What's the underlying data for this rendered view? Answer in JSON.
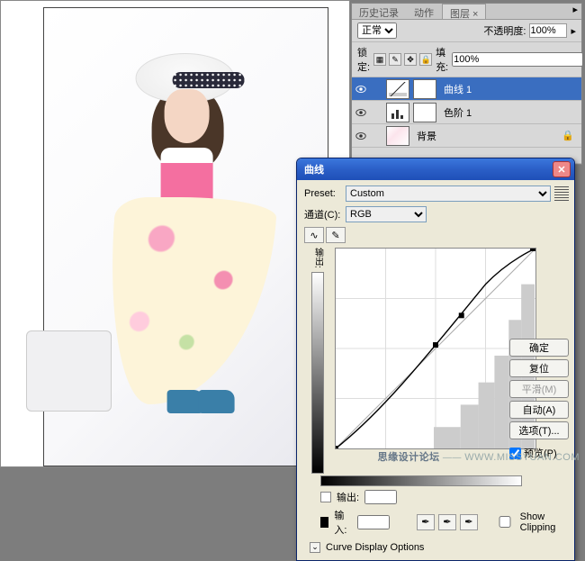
{
  "panel": {
    "tabs": [
      "历史记录",
      "动作",
      "图层"
    ],
    "active_tab": "图层",
    "blend_mode": "正常",
    "opacity_label": "不透明度:",
    "opacity_value": "100%",
    "lock_label": "锁定:",
    "fill_label": "填充:",
    "fill_value": "100%",
    "layers": [
      {
        "name": "曲线 1",
        "kind": "curves",
        "selected": true
      },
      {
        "name": "色阶 1",
        "kind": "levels",
        "selected": false
      },
      {
        "name": "背景",
        "kind": "image",
        "selected": false
      }
    ]
  },
  "curves_dialog": {
    "title": "曲线",
    "preset_label": "Preset:",
    "preset_value": "Custom",
    "channel_label": "通道(C):",
    "channel_value": "RGB",
    "output_label": "输出:",
    "input_label": "输入:",
    "show_clipping": "Show Clipping",
    "expander": "Curve Display Options",
    "ok": "确定",
    "cancel": "复位",
    "smooth": "平滑(M)",
    "auto": "自动(A)",
    "options": "选项(T)...",
    "preview": "预览(P)"
  },
  "chart_data": {
    "type": "line",
    "title": "曲线",
    "xlabel": "输入",
    "ylabel": "输出",
    "xlim": [
      0,
      255
    ],
    "ylim": [
      0,
      255
    ],
    "series": [
      {
        "name": "baseline",
        "x": [
          0,
          255
        ],
        "y": [
          0,
          255
        ]
      },
      {
        "name": "curve",
        "x": [
          0,
          64,
          128,
          192,
          255
        ],
        "y": [
          0,
          52,
          132,
          210,
          255
        ]
      }
    ],
    "control_points": [
      {
        "x": 0,
        "y": 0
      },
      {
        "x": 128,
        "y": 132
      },
      {
        "x": 160,
        "y": 170
      },
      {
        "x": 255,
        "y": 255
      }
    ]
  },
  "watermark": {
    "brand": "思缘设计论坛",
    "url": "WWW.MISSYUAN.COM"
  }
}
